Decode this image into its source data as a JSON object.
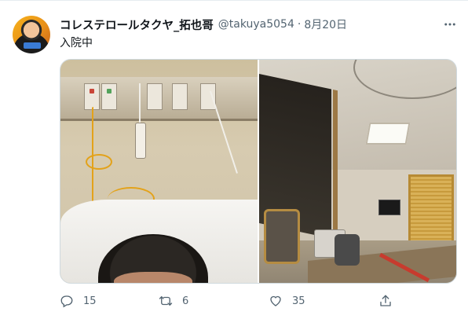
{
  "author": {
    "display_name": "コレステロールタクヤ_拓也哥",
    "handle": "@takuya5054",
    "separator": "·",
    "date": "8月20日"
  },
  "tweet": {
    "text": "入院中"
  },
  "actions": {
    "reply_count": "15",
    "retweet_count": "6",
    "like_count": "35"
  },
  "icons": {
    "more": "more-icon",
    "reply": "reply-icon",
    "retweet": "retweet-icon",
    "like": "heart-icon",
    "share": "share-icon"
  },
  "colors": {
    "text_primary": "#0f1419",
    "text_secondary": "#536471",
    "border": "#cfd9de"
  }
}
